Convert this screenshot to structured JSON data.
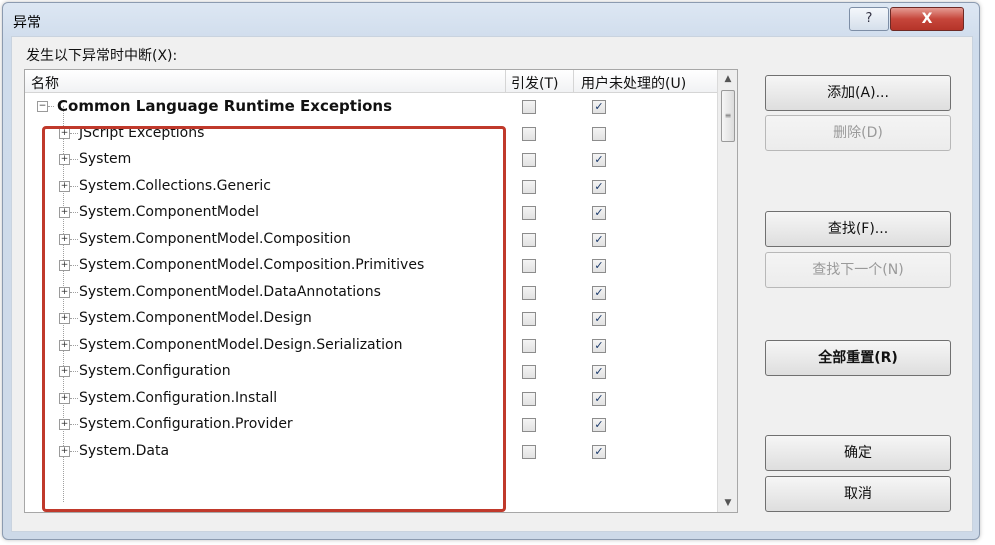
{
  "window": {
    "title": "异常",
    "help_label": "?",
    "close_label": "X"
  },
  "section_label": "发生以下异常时中断(X):",
  "columns": {
    "name": "名称",
    "thrown": "引发(T)",
    "user_unhandled": "用户未处理的(U)"
  },
  "rows": [
    {
      "label": "Common Language Runtime Exceptions",
      "expander": "−",
      "thrown": false,
      "user_unhandled": true
    },
    {
      "label": "JScript Exceptions",
      "expander": "+",
      "thrown": false,
      "user_unhandled": false
    },
    {
      "label": "System",
      "expander": "+",
      "thrown": false,
      "user_unhandled": true
    },
    {
      "label": "System.Collections.Generic",
      "expander": "+",
      "thrown": false,
      "user_unhandled": true
    },
    {
      "label": "System.ComponentModel",
      "expander": "+",
      "thrown": false,
      "user_unhandled": true
    },
    {
      "label": "System.ComponentModel.Composition",
      "expander": "+",
      "thrown": false,
      "user_unhandled": true
    },
    {
      "label": "System.ComponentModel.Composition.Primitives",
      "expander": "+",
      "thrown": false,
      "user_unhandled": true
    },
    {
      "label": "System.ComponentModel.DataAnnotations",
      "expander": "+",
      "thrown": false,
      "user_unhandled": true
    },
    {
      "label": "System.ComponentModel.Design",
      "expander": "+",
      "thrown": false,
      "user_unhandled": true
    },
    {
      "label": "System.ComponentModel.Design.Serialization",
      "expander": "+",
      "thrown": false,
      "user_unhandled": true
    },
    {
      "label": "System.Configuration",
      "expander": "+",
      "thrown": false,
      "user_unhandled": true
    },
    {
      "label": "System.Configuration.Install",
      "expander": "+",
      "thrown": false,
      "user_unhandled": true
    },
    {
      "label": "System.Configuration.Provider",
      "expander": "+",
      "thrown": false,
      "user_unhandled": true
    },
    {
      "label": "System.Data",
      "expander": "+",
      "thrown": false,
      "user_unhandled": true
    }
  ],
  "buttons": {
    "add": "添加(A)...",
    "delete": "删除(D)",
    "find": "查找(F)...",
    "find_next": "查找下一个(N)",
    "reset_all": "全部重置(R)",
    "ok": "确定",
    "cancel": "取消"
  },
  "colors": {
    "highlight_border": "#c0392b",
    "close_button": "#c6463b"
  }
}
